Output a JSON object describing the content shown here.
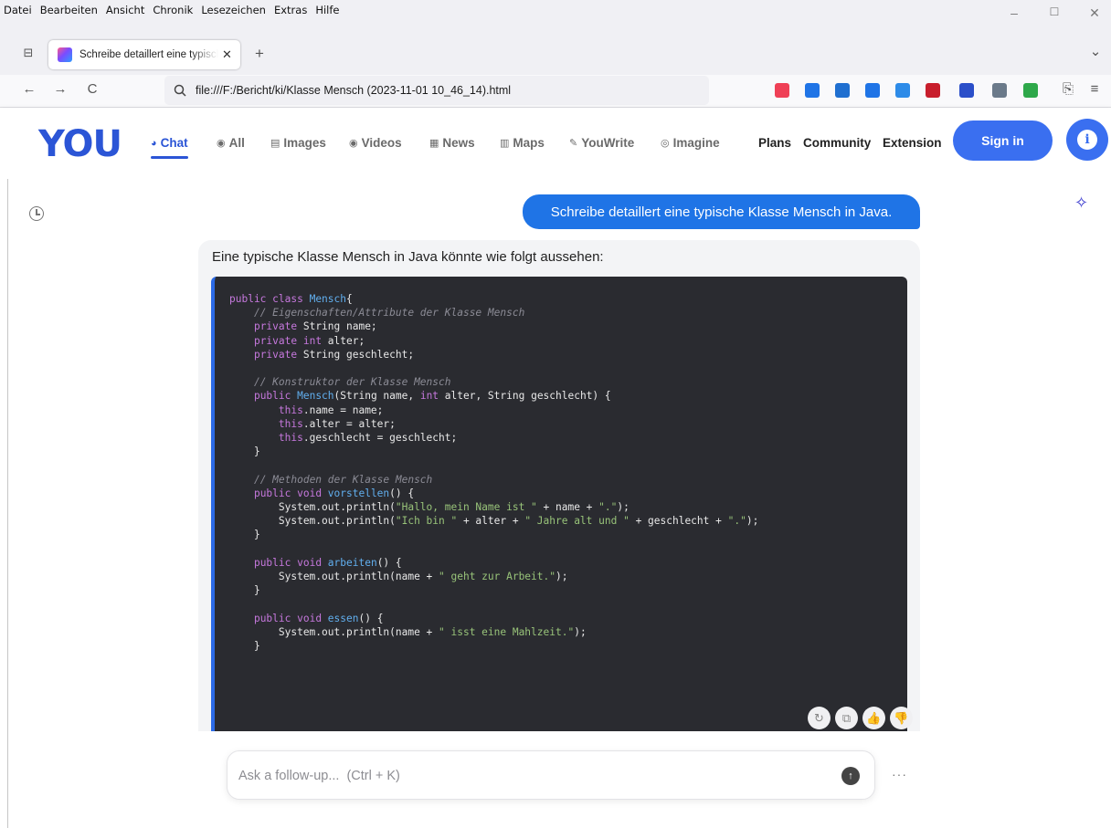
{
  "window": {
    "menu": [
      "Datei",
      "Bearbeiten",
      "Ansicht",
      "Chronik",
      "Lesezeichen",
      "Extras",
      "Hilfe"
    ],
    "controls": {
      "minimize": "–",
      "maximize": "☐",
      "close": "✕"
    }
  },
  "tabs": [
    {
      "title": "Schreibe detaillert eine typische Klasse Mensch in Java.",
      "close": "✕"
    }
  ],
  "newtab": "+",
  "tablist_chevron": "⌄",
  "toolbar": {
    "back": "←",
    "forward": "→",
    "reload": "C",
    "url": "file:///F:/Bericht/ki/Klasse Mensch (2023-11-01 10_46_14).html",
    "menu_icon": "≡"
  },
  "extensions": [
    {
      "name": "pocket-icon",
      "color": "#ef4056"
    },
    {
      "name": "download-icon",
      "color": "#1f74e6"
    },
    {
      "name": "ext-badge-icon",
      "color": "#1f6fd0"
    },
    {
      "name": "ext-s-icon",
      "color": "#1f74e6"
    },
    {
      "name": "ext-puzzle-icon",
      "color": "#2d8be8"
    },
    {
      "name": "ext-red-icon",
      "color": "#c81e2c"
    },
    {
      "name": "ext-m-icon",
      "color": "#2b4fc9"
    },
    {
      "name": "ext-download2-icon",
      "color": "#6b7a8a"
    },
    {
      "name": "ext-green-icon",
      "color": "#2ea84a"
    }
  ],
  "site": {
    "logo": "YOU",
    "nav": [
      {
        "id": "chat",
        "label": "Chat",
        "icon": "◕",
        "active": true
      },
      {
        "id": "all",
        "label": "All",
        "icon": "◉"
      },
      {
        "id": "images",
        "label": "Images",
        "icon": "▤"
      },
      {
        "id": "videos",
        "label": "Videos",
        "icon": "◉"
      },
      {
        "id": "news",
        "label": "News",
        "icon": "▦"
      },
      {
        "id": "maps",
        "label": "Maps",
        "icon": "▥"
      },
      {
        "id": "youwrite",
        "label": "YouWrite",
        "icon": "✎"
      },
      {
        "id": "imagine",
        "label": "Imagine",
        "icon": "◎"
      }
    ],
    "plans": "Plans",
    "community": "Community",
    "extension": "Extension",
    "signin": "Sign in",
    "avatar_glyph": "i"
  },
  "chat": {
    "user_message": "Schreibe detaillert eine typische Klasse Mensch in Java.",
    "answer_intro": "Eine typische Klasse Mensch in Java könnte wie folgt aussehen:",
    "code_lines": [
      [
        [
          "kw",
          "public "
        ],
        [
          "kw",
          "class "
        ],
        [
          "fn",
          "Mensch"
        ],
        [
          "",
          "{"
        ]
      ],
      [
        [
          "",
          "    "
        ],
        [
          "cm",
          "// Eigenschaften/Attribute der Klasse Mensch"
        ]
      ],
      [
        [
          "",
          "    "
        ],
        [
          "kw",
          "private "
        ],
        [
          "",
          "String name;"
        ]
      ],
      [
        [
          "",
          "    "
        ],
        [
          "kw",
          "private "
        ],
        [
          "kw",
          "int "
        ],
        [
          "",
          "alter;"
        ]
      ],
      [
        [
          "",
          "    "
        ],
        [
          "kw",
          "private "
        ],
        [
          "",
          "String geschlecht;"
        ]
      ],
      [
        [
          "",
          ""
        ]
      ],
      [
        [
          "",
          "    "
        ],
        [
          "cm",
          "// Konstruktor der Klasse Mensch"
        ]
      ],
      [
        [
          "",
          "    "
        ],
        [
          "kw",
          "public "
        ],
        [
          "fn",
          "Mensch"
        ],
        [
          "",
          "(String name, "
        ],
        [
          "kw",
          "int "
        ],
        [
          "",
          "alter, String geschlecht) {"
        ]
      ],
      [
        [
          "",
          "        "
        ],
        [
          "kw",
          "this"
        ],
        [
          "",
          ".name = name;"
        ]
      ],
      [
        [
          "",
          "        "
        ],
        [
          "kw",
          "this"
        ],
        [
          "",
          ".alter = alter;"
        ]
      ],
      [
        [
          "",
          "        "
        ],
        [
          "kw",
          "this"
        ],
        [
          "",
          ".geschlecht = geschlecht;"
        ]
      ],
      [
        [
          "",
          "    }"
        ]
      ],
      [
        [
          "",
          ""
        ]
      ],
      [
        [
          "",
          "    "
        ],
        [
          "cm",
          "// Methoden der Klasse Mensch"
        ]
      ],
      [
        [
          "",
          "    "
        ],
        [
          "kw",
          "public "
        ],
        [
          "kw",
          "void "
        ],
        [
          "fn",
          "vorstellen"
        ],
        [
          "",
          "() {"
        ]
      ],
      [
        [
          "",
          "        System.out.println("
        ],
        [
          "str",
          "\"Hallo, mein Name ist \""
        ],
        [
          "",
          " + name + "
        ],
        [
          "str",
          "\".\""
        ],
        [
          "",
          ");"
        ]
      ],
      [
        [
          "",
          "        System.out.println("
        ],
        [
          "str",
          "\"Ich bin \""
        ],
        [
          "",
          " + alter + "
        ],
        [
          "str",
          "\" Jahre alt und \""
        ],
        [
          "",
          " + geschlecht + "
        ],
        [
          "str",
          "\".\""
        ],
        [
          "",
          ");"
        ]
      ],
      [
        [
          "",
          "    }"
        ]
      ],
      [
        [
          "",
          ""
        ]
      ],
      [
        [
          "",
          "    "
        ],
        [
          "kw",
          "public "
        ],
        [
          "kw",
          "void "
        ],
        [
          "fn",
          "arbeiten"
        ],
        [
          "",
          "() {"
        ]
      ],
      [
        [
          "",
          "        System.out.println(name + "
        ],
        [
          "str",
          "\" geht zur Arbeit.\""
        ],
        [
          "",
          ");"
        ]
      ],
      [
        [
          "",
          "    }"
        ]
      ],
      [
        [
          "",
          ""
        ]
      ],
      [
        [
          "",
          "    "
        ],
        [
          "kw",
          "public "
        ],
        [
          "kw",
          "void "
        ],
        [
          "fn",
          "essen"
        ],
        [
          "",
          "() {"
        ]
      ],
      [
        [
          "",
          "        System.out.println(name + "
        ],
        [
          "str",
          "\" isst eine Mahlzeit.\""
        ],
        [
          "",
          ");"
        ]
      ],
      [
        [
          "",
          "    }"
        ]
      ]
    ],
    "actions": [
      {
        "name": "regenerate-icon",
        "glyph": "↻"
      },
      {
        "name": "copy-icon",
        "glyph": "⧉"
      },
      {
        "name": "thumbs-up-icon",
        "glyph": "👍"
      },
      {
        "name": "thumbs-down-icon",
        "glyph": "👎"
      }
    ],
    "input_placeholder": "Ask a follow-up...  (Ctrl + K)",
    "send_glyph": "↑",
    "more_glyph": "···"
  }
}
